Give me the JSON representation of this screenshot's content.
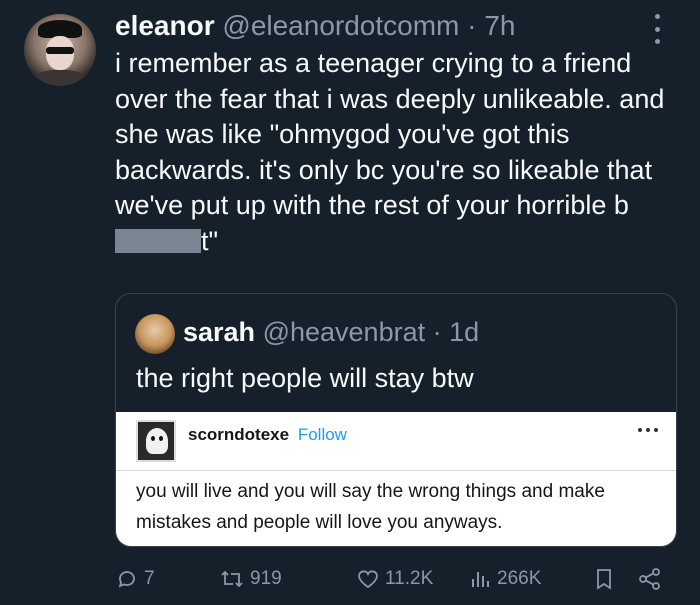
{
  "tweet": {
    "name": "eleanor",
    "handle": "@eleanordotcomm",
    "separator": "·",
    "time": "7h",
    "text_before": "i remember as a teenager crying to a friend over the fear that i was deeply unlikeable. and she was like \"ohmygod you've got this backwards. it's only bc you're so likeable that we've put up with the rest of your horrible b",
    "text_after": "t\""
  },
  "quote": {
    "name": "sarah",
    "handle": "@heavenbrat",
    "separator": "·",
    "time": "1d",
    "text": "the right people will stay btw",
    "embed": {
      "username": "scorndotexe",
      "follow_label": "Follow",
      "text": "you will live and you will say the wrong things and make mistakes and people will love you anyways."
    }
  },
  "actions": {
    "replies": "7",
    "retweets": "919",
    "likes": "11.2K",
    "views": "266K"
  },
  "icons": [
    "more-icon",
    "reply-icon",
    "retweet-icon",
    "like-icon",
    "views-icon",
    "bookmark-icon",
    "share-icon"
  ],
  "colors": {
    "background": "#15202b",
    "text": "#f7f9f9",
    "muted": "#8b98a5",
    "link": "#1d9bf0",
    "border": "#38444d"
  }
}
